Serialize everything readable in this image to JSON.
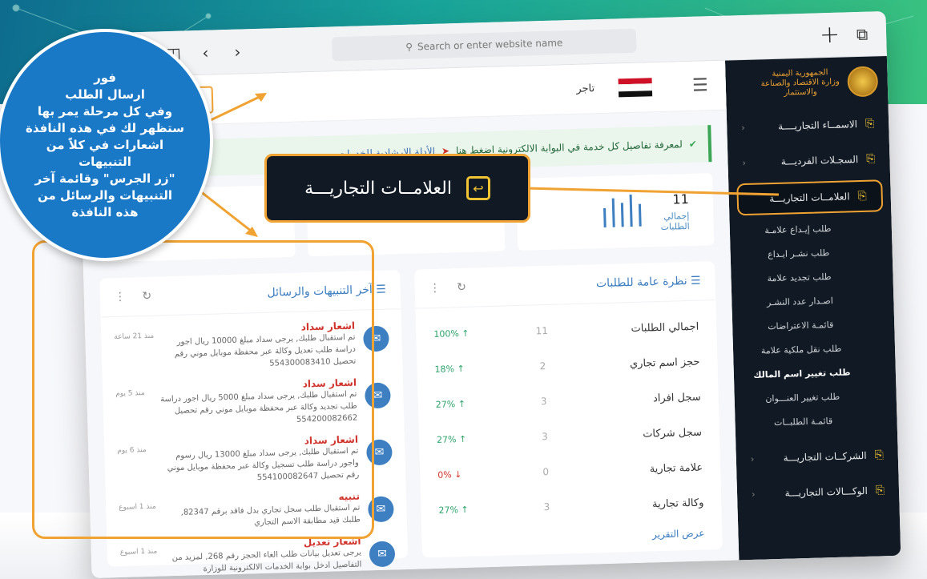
{
  "browser": {
    "url_placeholder": "Search or enter website name"
  },
  "topbar": {
    "merchant_label": "تاجر"
  },
  "sidebar": {
    "ministry_lines": [
      "الجمهورية اليمنية",
      "وزارة الاقتصاد والصناعة",
      "والاستثمار"
    ],
    "items": [
      {
        "label": "الاسمــاء التجاريــــة",
        "has_chevron": true
      },
      {
        "label": "السجـلات الفرديـــة",
        "has_chevron": true
      },
      {
        "label": "العلامــات التجاريـــة",
        "active": true
      }
    ],
    "sub_items": [
      "طلب إيـداع علامـة",
      "طلب نشـر ايـداع",
      "طلب تجديد علامة",
      "اصـدار عدد النشـر",
      "قائمـة الاعتراضات",
      "طلب نقل ملكية علامة",
      "طلب تغيير اسم المالك",
      "طلب تغيير العنـــوان",
      "قائمـة الطلبــات"
    ],
    "bottom_items": [
      {
        "label": "الشركــات التجاريـــة"
      },
      {
        "label": "الوكـــالات التجاريـــة"
      }
    ]
  },
  "notice": {
    "text": "لمعرفة تفاصيل كل خدمة في البوابة الالكترونية اضغط هنا",
    "link": "الأدلة الإرشادية للخدمات"
  },
  "stats": {
    "total_value": "11",
    "total_label": "إجمالي الطلبات"
  },
  "overview": {
    "title": "نظرة عامة للطلبات",
    "rows": [
      {
        "name": "اجمالي الطلبات",
        "count": "11",
        "pct": "100%",
        "dir": "up"
      },
      {
        "name": "حجز اسم تجاري",
        "count": "2",
        "pct": "18%",
        "dir": "up"
      },
      {
        "name": "سجل افراد",
        "count": "3",
        "pct": "27%",
        "dir": "up"
      },
      {
        "name": "سجل شركات",
        "count": "3",
        "pct": "27%",
        "dir": "up"
      },
      {
        "name": "علامة تجارية",
        "count": "0",
        "pct": "0%",
        "dir": "down"
      },
      {
        "name": "وكالة تجارية",
        "count": "3",
        "pct": "27%",
        "dir": "up"
      }
    ],
    "report_link": "عرض التقرير"
  },
  "notifications": {
    "title": "آخر التنبيهات والرسائل",
    "items": [
      {
        "title": "اشعار سداد",
        "message": "تم استقبال طلبك, يرجى سداد مبلغ 10000 ريال اجور دراسة طلب تعديل وكالة عبر محفظة موبايل موني رقم تحصيل 554300083410",
        "time": "منذ 21 ساعة"
      },
      {
        "title": "اشعار سداد",
        "message": "تم استقبال طلبك, يرجى سداد مبلغ 5000 ريال اجور دراسة طلب تجديد وكالة عبر محفظة موبايل موني رقم تحصيل 554200082662",
        "time": "منذ 5 يوم"
      },
      {
        "title": "اشعار سداد",
        "message": "تم استقبال طلبك, يرجى سداد مبلغ 13000 ريال رسوم واجور دراسة طلب تسجيل وكالة عبر محفظة موبايل موني رقم تحصيل 554100082647",
        "time": "منذ 6 يوم"
      },
      {
        "title": "تنبيه",
        "message": "تم استقبال طلب سجل تجاري بدل فاقد برقم 82347, طلبك قيد مطابقة الاسم التجاري",
        "time": "منذ 1 اسبوع"
      },
      {
        "title": "اشعار تعديل",
        "message": "يرجى تعديل بيانات طلب الغاء الحجز رقم 268, لمزيد من التفاصيل ادخل بوابة الخدمات الالكترونية للوزارة",
        "time": "منذ 1 اسبوع"
      }
    ]
  },
  "callouts": {
    "trademark_label": "العلامــات التجاريـــة",
    "bubble_lines": [
      "فور",
      "ارسال الطلب",
      "وفي كل مرحلة يمر بها",
      "ستظهر لك في هذه النافذة",
      "اشعارات في كلاً من التنبيهات",
      "\"زر الجرس\" وقائمة آخر",
      "التنبيهات والرسائل من",
      "هذه النافذة"
    ]
  },
  "colors": {
    "accent": "#f0a232",
    "sidebar_bg": "#111a24",
    "primary_blue": "#3d7fc1",
    "alert_red": "#d0342c",
    "bubble_blue": "#1a79c7"
  }
}
